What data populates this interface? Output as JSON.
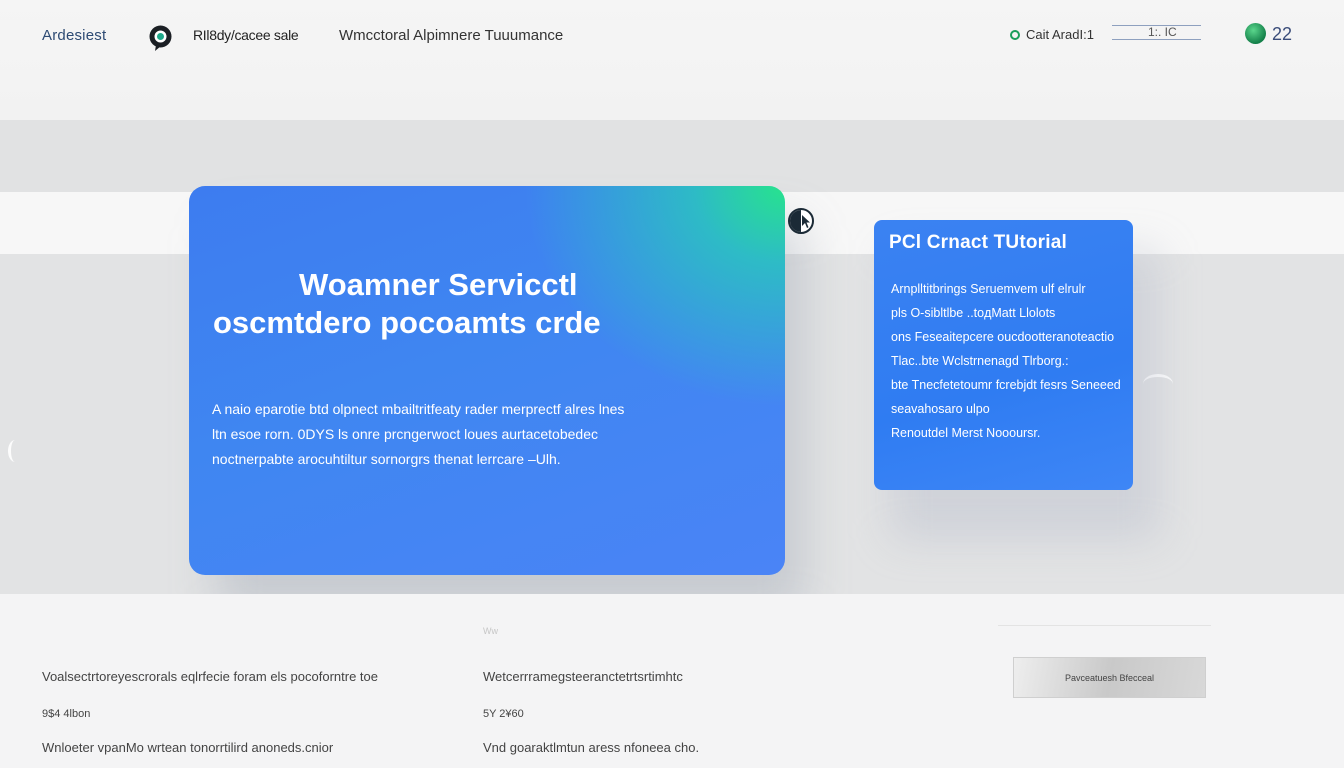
{
  "header": {
    "brand": "Ardesiest",
    "logo_icon": "chat-bubble-icon",
    "product_name": "RIl8dу/сасее sаlе",
    "page_heading": "Wmcctoral Alpimnere Tuuumance",
    "status_label": "Cait AradІ:1",
    "search_value": "1:. ІС",
    "notif_count": "22"
  },
  "hero": {
    "title_line1": "Woamner Servicctl",
    "title_line2": "oscmtdero pocoamts crde",
    "body_lines": [
      "A naio eparotie btd olpnect mbailtritfeaty rader merprectf alres lnes",
      "ltn esoe rorn. 0DYS ls onre prcngerwoct loues aurtacetobedec",
      "noctnerpabte arocuhtiltur sornorgrs thenat lerrcare –Ulh."
    ]
  },
  "tutorial": {
    "title": "PCl Crnact TUtorial",
    "body_lines": [
      "Arnplltitbrings Seruemvem ulf elrulr",
      "pls O-sіbltlbe ..toдMatt Llolots",
      "ons Feseaitepcere oucdootteranoteactio",
      "Tlac..bte Wclstrnenagd Tlrborg.:",
      "bte Tnecfetetoumr fcrebjdt fesrs Seneeed",
      "seavahosaro ulpo",
      "Renoutdel Merst Noooursr."
    ]
  },
  "footer": {
    "col1_title": "Voalsectrtoreyescrorals eqlrfecie foram els pocoforntre toe",
    "col1_date": "9$4 4lbon",
    "col1_text": "Wnloeter vpanMo wrtean tonorrtilird anoneds.cnior",
    "col2_faint": "Ww",
    "col2_title": "Wetcerrramegsteeranctetrtsrtimhtc",
    "col2_date": "5Y 2¥60",
    "col2_text": "Vnd goaraktlmtun aress nfoneea cho.",
    "button_label": "Pavceatuesh Bfecceal"
  }
}
